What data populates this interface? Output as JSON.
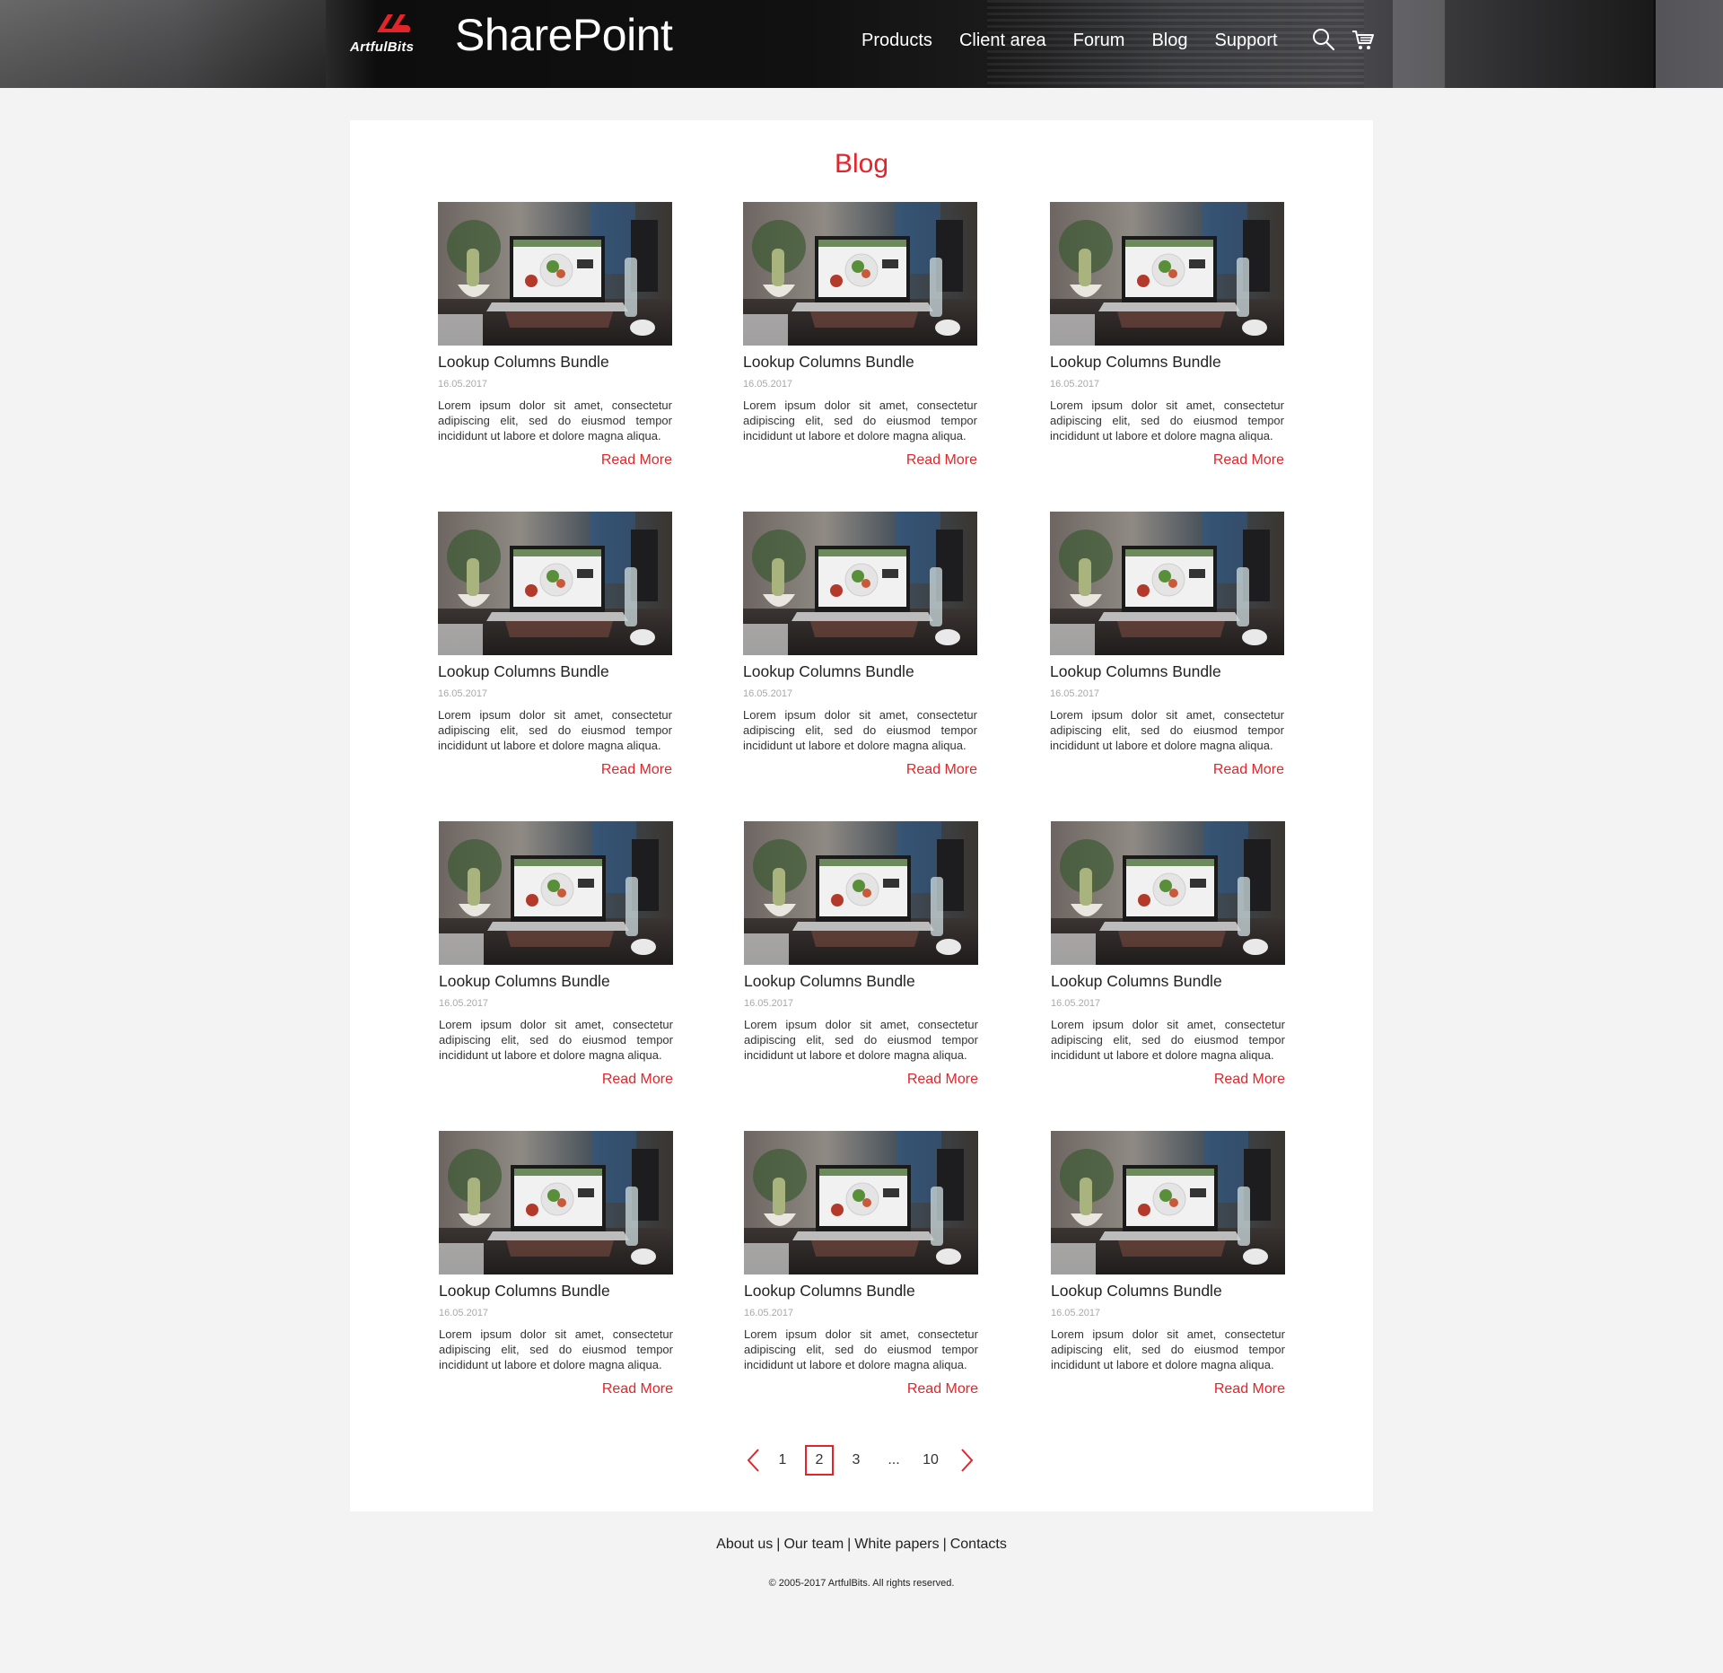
{
  "header": {
    "logo_text": "ArtfulBits",
    "brand_title": "SharePoint",
    "nav": [
      {
        "label": "Products"
      },
      {
        "label": "Client area"
      },
      {
        "label": "Forum"
      },
      {
        "label": "Blog"
      },
      {
        "label": "Support"
      }
    ],
    "search_icon": "search-icon",
    "cart_icon": "cart-icon"
  },
  "main": {
    "title": "Blog",
    "posts": [
      {
        "title": "Lookup Columns Bundle",
        "date": "16.05.2017",
        "excerpt": "Lorem ipsum dolor sit amet, consectetur adipiscing elit, sed do eiusmod tempor incididunt ut labore et dolore magna aliqua.",
        "read_more": "Read More"
      },
      {
        "title": "Lookup Columns Bundle",
        "date": "16.05.2017",
        "excerpt": "Lorem ipsum dolor sit amet, consectetur adipiscing elit, sed do eiusmod tempor incididunt ut labore et dolore magna aliqua.",
        "read_more": "Read More"
      },
      {
        "title": "Lookup Columns Bundle",
        "date": "16.05.2017",
        "excerpt": "Lorem ipsum dolor sit amet, consectetur adipiscing elit, sed do eiusmod tempor incididunt ut labore et dolore magna aliqua.",
        "read_more": "Read More"
      },
      {
        "title": "Lookup Columns Bundle",
        "date": "16.05.2017",
        "excerpt": "Lorem ipsum dolor sit amet, consectetur adipiscing elit, sed do eiusmod tempor incididunt ut labore et dolore magna aliqua.",
        "read_more": "Read More"
      },
      {
        "title": "Lookup Columns Bundle",
        "date": "16.05.2017",
        "excerpt": "Lorem ipsum dolor sit amet, consectetur adipiscing elit, sed do eiusmod tempor incididunt ut labore et dolore magna aliqua.",
        "read_more": "Read More"
      },
      {
        "title": "Lookup Columns Bundle",
        "date": "16.05.2017",
        "excerpt": "Lorem ipsum dolor sit amet, consectetur adipiscing elit, sed do eiusmod tempor incididunt ut labore et dolore magna aliqua.",
        "read_more": "Read More"
      },
      {
        "title": "Lookup Columns Bundle",
        "date": "16.05.2017",
        "excerpt": "Lorem ipsum dolor sit amet, consectetur adipiscing elit, sed do eiusmod tempor incididunt ut labore et dolore magna aliqua.",
        "read_more": "Read More"
      },
      {
        "title": "Lookup Columns Bundle",
        "date": "16.05.2017",
        "excerpt": "Lorem ipsum dolor sit amet, consectetur adipiscing elit, sed do eiusmod tempor incididunt ut labore et dolore magna aliqua.",
        "read_more": "Read More"
      },
      {
        "title": "Lookup Columns Bundle",
        "date": "16.05.2017",
        "excerpt": "Lorem ipsum dolor sit amet, consectetur adipiscing elit, sed do eiusmod tempor incididunt ut labore et dolore magna aliqua.",
        "read_more": "Read More"
      },
      {
        "title": "Lookup Columns Bundle",
        "date": "16.05.2017",
        "excerpt": "Lorem ipsum dolor sit amet, consectetur adipiscing elit, sed do eiusmod tempor incididunt ut labore et dolore magna aliqua.",
        "read_more": "Read More"
      },
      {
        "title": "Lookup Columns Bundle",
        "date": "16.05.2017",
        "excerpt": "Lorem ipsum dolor sit amet, consectetur adipiscing elit, sed do eiusmod tempor incididunt ut labore et dolore magna aliqua.",
        "read_more": "Read More"
      },
      {
        "title": "Lookup Columns Bundle",
        "date": "16.05.2017",
        "excerpt": "Lorem ipsum dolor sit amet, consectetur adipiscing elit, sed do eiusmod tempor incididunt ut labore et dolore magna aliqua.",
        "read_more": "Read More"
      }
    ]
  },
  "pagination": {
    "pages": [
      "1",
      "2",
      "3",
      "...",
      "10"
    ],
    "current": "2",
    "prev_icon": "chevron-left-icon",
    "next_icon": "chevron-right-icon"
  },
  "footer": {
    "links": [
      "About us",
      "Our team",
      "White papers",
      "Contacts"
    ],
    "separator": "|",
    "copyright": "© 2005-2017 ArtfulBits. All rights reserved."
  },
  "colors": {
    "accent": "#e1252a",
    "page_bg": "#f2f3f2",
    "card_bg": "#ffffff",
    "header_bg": "#111111"
  }
}
